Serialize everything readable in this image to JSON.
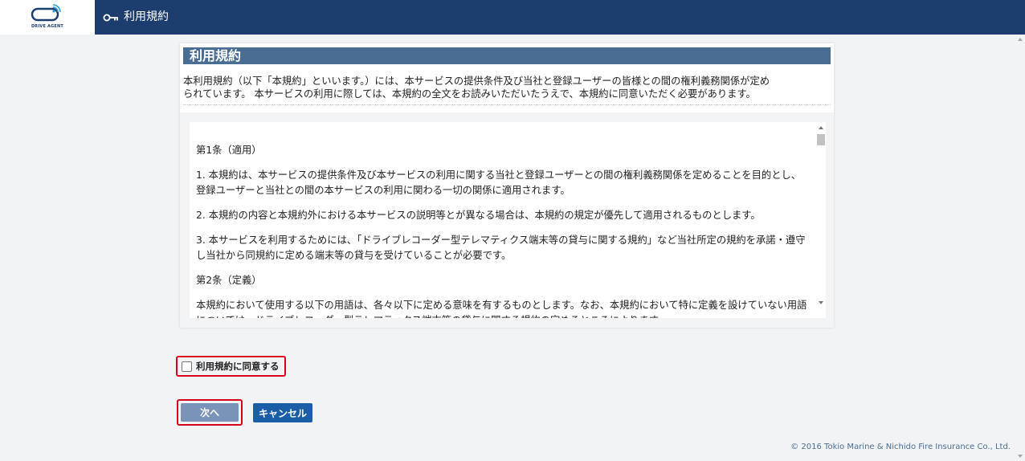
{
  "header": {
    "logo_text": "DRIVE AGENT",
    "title": "利用規約",
    "bg_color": "#1c3d6e"
  },
  "terms_page": {
    "section_title": "利用規約",
    "intro": "本利用規約（以下「本規約」といいます。）には、本サービスの提供条件及び当社と登録ユーザーの皆様との間の権利義務関係が定め\nられています。 本サービスの利用に際しては、本規約の全文をお読みいただいたうえで、本規約に同意いただく必要があります。",
    "paragraphs": [
      "第1条（適用）",
      "1. 本規約は、本サービスの提供条件及び本サービスの利用に関する当社と登録ユーザーとの間の権利義務関係を定めることを目的とし、登録ユーザーと当社との間の本サービスの利用に関わる一切の関係に適用されます。",
      "2. 本規約の内容と本規約外における本サービスの説明等とが異なる場合は、本規約の規定が優先して適用されるものとします。",
      "3.  本サービスを利用するためには、「ドライブレコーダー型テレマティクス端末等の貸与に関する規約」など当社所定の規約を承諾・遵守し当社から同規約に定める端末等の貸与を受けていることが必要です。",
      "第2条（定義）",
      "本規約において使用する以下の用語は、各々以下に定める意味を有するものとします。なお、本規約において特に定義を設けていない用語については、ドライブレコーダー型テレマティクス端末等の貸与に関する規約の定めるところによります。"
    ]
  },
  "agree": {
    "label": "利用規約に同意する",
    "checked": false
  },
  "buttons": {
    "next_label": "次へ",
    "cancel_label": "キャンセル"
  },
  "footer": {
    "copyright": "© 2016 Tokio Marine & Nichido Fire Insurance Co., Ltd."
  },
  "colors": {
    "accent": "#4a6d94",
    "highlight_border": "#d6001c",
    "cancel_button": "#1a5ea8",
    "next_button": "#7994b8"
  }
}
